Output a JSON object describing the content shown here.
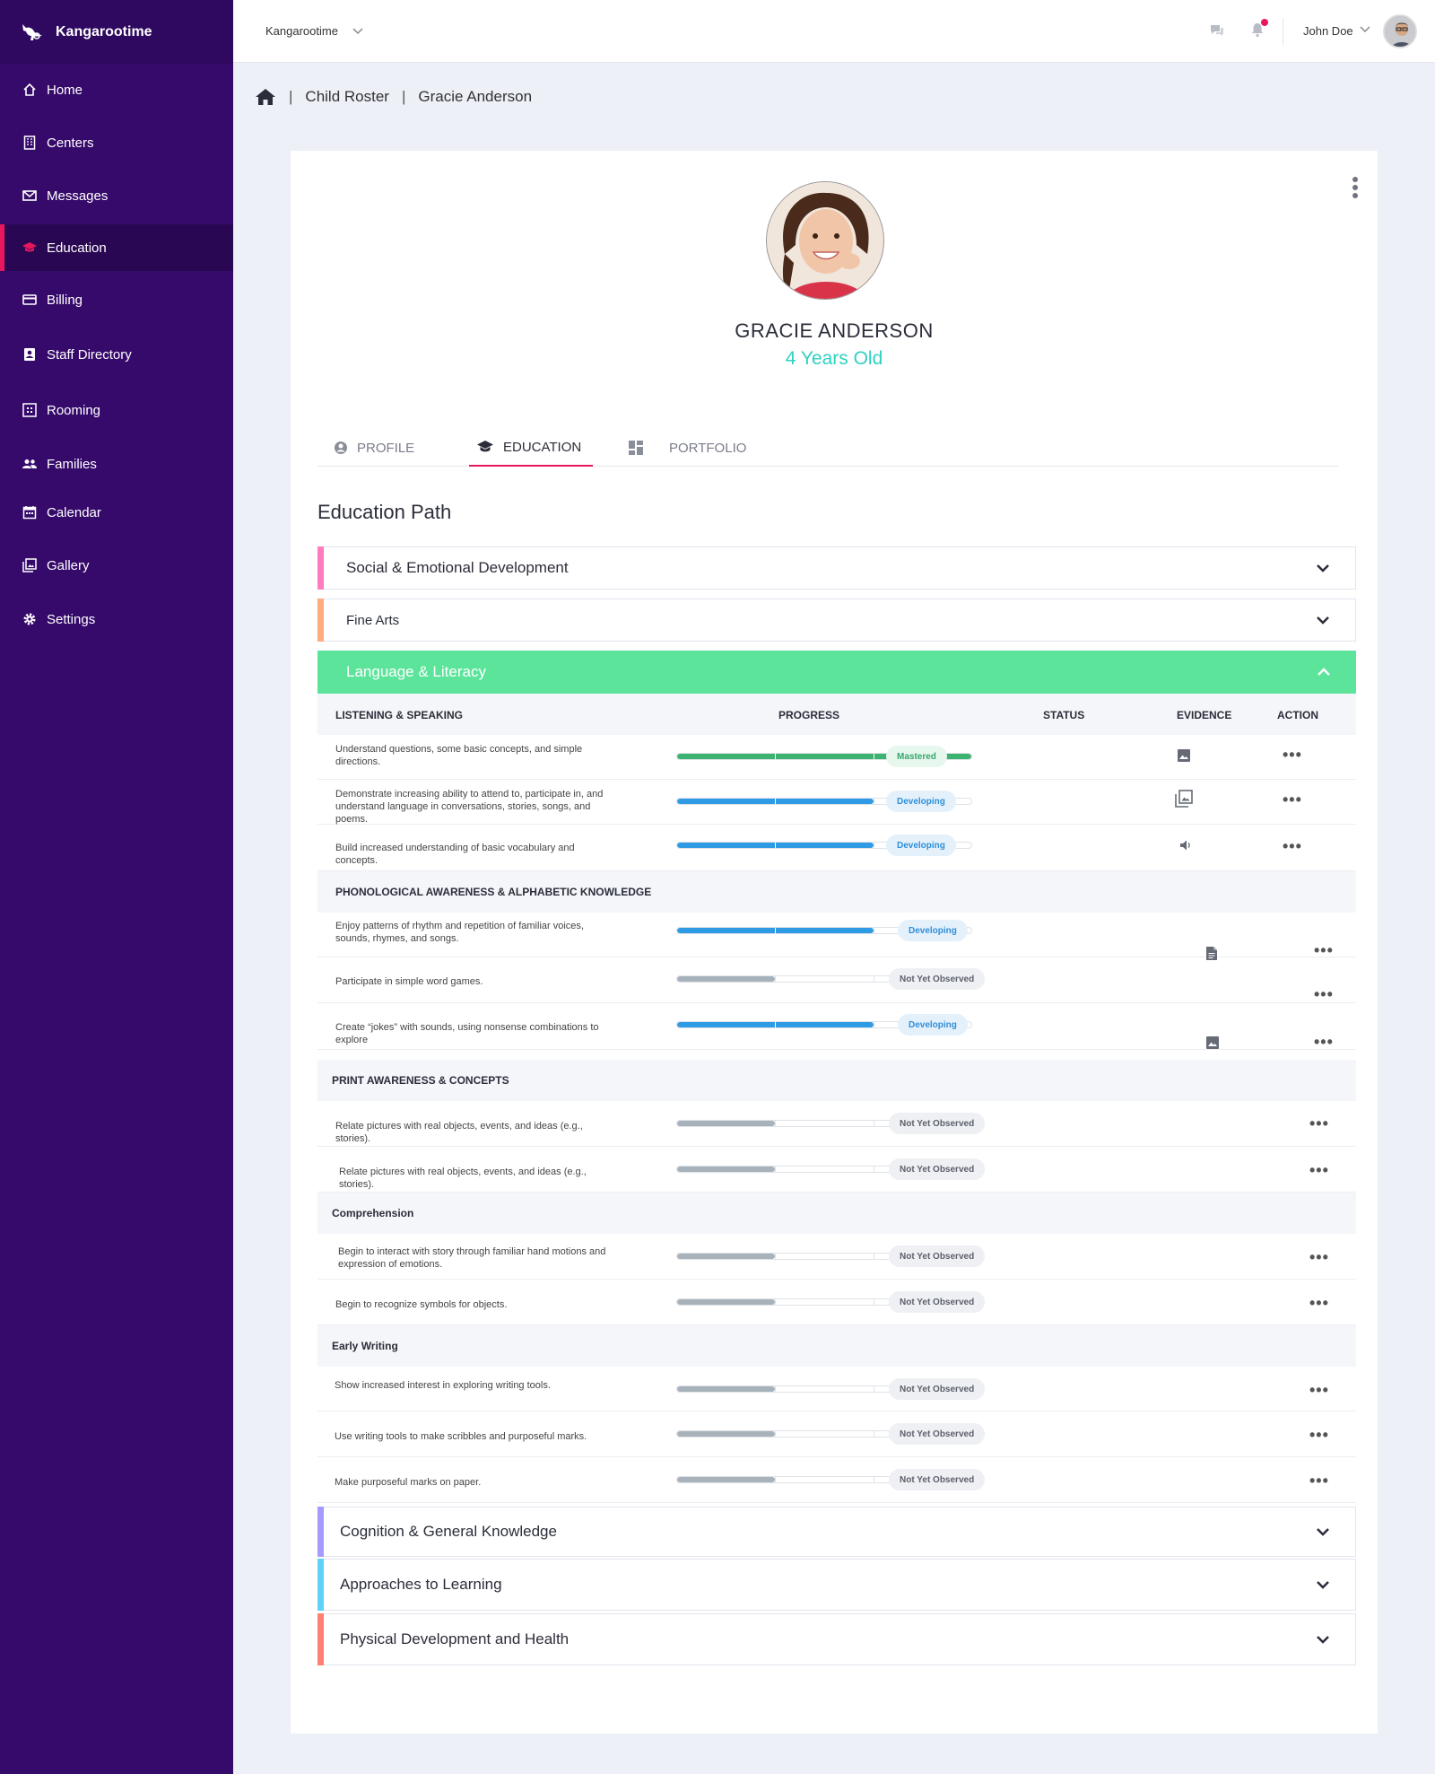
{
  "app": {
    "name": "Kangarootime"
  },
  "sidebar": {
    "items": [
      {
        "label": "Home",
        "icon": "home-icon"
      },
      {
        "label": "Centers",
        "icon": "building-icon"
      },
      {
        "label": "Messages",
        "icon": "mail-icon"
      },
      {
        "label": "Education",
        "icon": "graduation-cap-icon",
        "active": true
      },
      {
        "label": "Billing",
        "icon": "credit-card-icon"
      },
      {
        "label": "Staff Directory",
        "icon": "contact-card-icon"
      },
      {
        "label": "Rooming",
        "icon": "grid-icon"
      },
      {
        "label": "Families",
        "icon": "people-icon"
      },
      {
        "label": "Calendar",
        "icon": "calendar-icon"
      },
      {
        "label": "Gallery",
        "icon": "gallery-icon"
      },
      {
        "label": "Settings",
        "icon": "gear-icon"
      }
    ]
  },
  "header": {
    "org": "Kangarootime",
    "user": "John Doe"
  },
  "breadcrumb": {
    "items": [
      "Child Roster",
      "Gracie Anderson"
    ]
  },
  "child": {
    "name": "GRACIE ANDERSON",
    "age": "4 Years Old"
  },
  "tabs": [
    {
      "label": "PROFILE"
    },
    {
      "label": "EDUCATION",
      "active": true
    },
    {
      "label": "PORTFOLIO"
    }
  ],
  "section_title": "Education Path",
  "colors": {
    "accent": "#e8175d",
    "sidebar": "#360a6b",
    "open_domain": "#5ce49b",
    "mastered": "#3cb371",
    "developing": "#2f9be4",
    "not_observed": "#a8b2bb",
    "age": "#2ed1c2"
  },
  "domains": {
    "social": {
      "label": "Social & Emotional Development",
      "color": "#ff7bc0"
    },
    "arts": {
      "label": "Fine Arts",
      "color": "#ffab7f"
    },
    "language": {
      "label": "Language & Literacy",
      "color": "#5ce49b"
    },
    "cognition": {
      "label": "Cognition & General Knowledge",
      "color": "#a59bff"
    },
    "approaches": {
      "label": "Approaches to Learning",
      "color": "#5fd3f5"
    },
    "physical": {
      "label": "Physical Development and Health",
      "color": "#ff7f73"
    }
  },
  "table": {
    "headers": {
      "first": "LISTENING & SPEAKING",
      "progress": "PROGRESS",
      "status": "STATUS",
      "evidence": "EVIDENCE",
      "action": "ACTION"
    },
    "groups": [
      "PHONOLOGICAL AWARENESS & ALPHABETIC KNOWLEDGE",
      "PRINT AWARENESS & CONCEPTS",
      "Comprehension",
      "Early Writing"
    ],
    "rows": [
      {
        "text": "Understand questions, some basic concepts, and simple directions.",
        "progress": 1.0,
        "status": "Mastered",
        "evidence": "image-icon"
      },
      {
        "text": "Demonstrate increasing ability to attend to, participate in, and understand language in conversations, stories, songs, and poems.",
        "progress": 0.667,
        "status": "Developing",
        "evidence": "gallery-icon"
      },
      {
        "text": "Build increased understanding of basic vocabulary and concepts.",
        "progress": 0.667,
        "status": "Developing",
        "evidence": "speaker-icon"
      },
      {
        "text": "Enjoy patterns of rhythm and repetition of familiar voices, sounds, rhymes, and songs.",
        "progress": 0.667,
        "status": "Developing",
        "evidence": "document-icon"
      },
      {
        "text": "Participate in simple word games.",
        "progress": 0.333,
        "status": "Not Yet Observed"
      },
      {
        "text": "Create “jokes” with sounds, using nonsense combinations to explore",
        "progress": 0.667,
        "status": "Developing",
        "evidence": "image-icon"
      },
      {
        "text": "Relate pictures with real objects, events, and ideas (e.g., stories).",
        "progress": 0.333,
        "status": "Not Yet Observed"
      },
      {
        "text": "Relate pictures with real objects, events, and ideas (e.g., stories).",
        "progress": 0.333,
        "status": "Not Yet Observed"
      },
      {
        "text": "Begin to interact with story through familiar hand motions and expression of emotions.",
        "progress": 0.333,
        "status": "Not Yet Observed"
      },
      {
        "text": "Begin to recognize symbols for objects.",
        "progress": 0.333,
        "status": "Not Yet Observed"
      },
      {
        "text": "Show increased interest in exploring writing tools.",
        "progress": 0.333,
        "status": "Not Yet Observed"
      },
      {
        "text": "Use writing tools to make scribbles and purposeful marks.",
        "progress": 0.333,
        "status": "Not Yet Observed"
      },
      {
        "text": "Make purposeful marks on paper.",
        "progress": 0.333,
        "status": "Not Yet Observed"
      }
    ],
    "action_label": "•••"
  }
}
